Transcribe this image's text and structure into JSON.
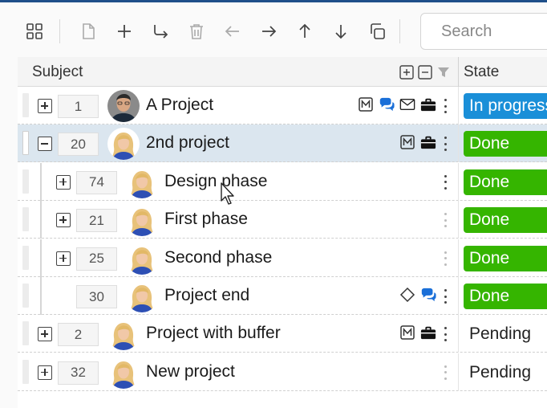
{
  "toolbar": {
    "buttons": [
      "grid-view",
      "new-document",
      "add",
      "indent",
      "delete",
      "back",
      "forward",
      "move-up",
      "move-down",
      "copy"
    ],
    "search_placeholder": "Search"
  },
  "columns": {
    "subject": "Subject",
    "state": "State"
  },
  "rows": [
    {
      "id": "1",
      "title": "A Project",
      "state": "In progress",
      "level": 0,
      "expander": "plus",
      "avatar": "man",
      "icons": [
        "m-icon",
        "chat-icon",
        "mail-icon",
        "briefcase-icon"
      ]
    },
    {
      "id": "20",
      "title": "2nd project",
      "state": "Done",
      "level": 0,
      "expander": "minus",
      "avatar": "woman",
      "icons": [
        "m-icon",
        "briefcase-icon"
      ]
    },
    {
      "id": "74",
      "title": "Design phase",
      "state": "Done",
      "level": 1,
      "expander": "plus",
      "avatar": "woman",
      "icons": []
    },
    {
      "id": "21",
      "title": "First phase",
      "state": "Done",
      "level": 1,
      "expander": "plus",
      "avatar": "woman",
      "icons": []
    },
    {
      "id": "25",
      "title": "Second phase",
      "state": "Done",
      "level": 1,
      "expander": "plus",
      "avatar": "woman",
      "icons": []
    },
    {
      "id": "30",
      "title": "Project end",
      "state": "Done",
      "level": 1,
      "expander": "none",
      "avatar": "woman",
      "icons": [
        "diamond-icon",
        "chat-icon"
      ]
    },
    {
      "id": "2",
      "title": "Project with buffer",
      "state": "Pending",
      "level": 0,
      "expander": "plus",
      "avatar": "woman",
      "icons": [
        "m-icon",
        "briefcase-icon"
      ]
    },
    {
      "id": "32",
      "title": "New project",
      "state": "Pending",
      "level": 0,
      "expander": "plus",
      "avatar": "woman",
      "icons": []
    }
  ],
  "colors": {
    "accent": "#1f4f8a",
    "in_progress": "#1a8fd8",
    "done": "#35b500",
    "selected_row": "#dbe6ef",
    "chat": "#1a6fd8"
  }
}
